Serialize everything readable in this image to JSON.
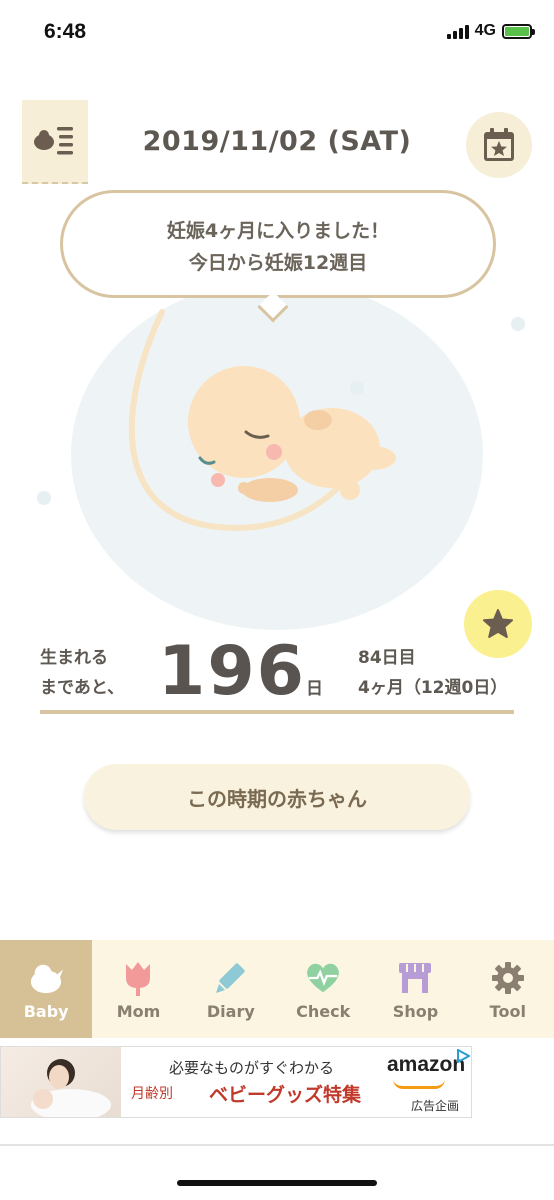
{
  "status": {
    "time": "6:48",
    "network": "4G"
  },
  "header": {
    "date": "2019/11/02 (SAT)"
  },
  "bubble": {
    "line1": "妊娠4ヶ月に入りました！",
    "line2": "今日から妊娠12週目"
  },
  "countdown": {
    "left_line1": "生まれる",
    "left_line2": "まであと、",
    "days": "196",
    "unit": "日",
    "right_line1": "84日目",
    "right_line2": "4ヶ月（12週0日）"
  },
  "baby_button": {
    "label": "この時期の赤ちゃん"
  },
  "tabs": [
    {
      "label": "Baby",
      "icon": "bird-icon",
      "active": true
    },
    {
      "label": "Mom",
      "icon": "tulip-icon",
      "active": false
    },
    {
      "label": "Diary",
      "icon": "pencil-icon",
      "active": false
    },
    {
      "label": "Check",
      "icon": "heart-pulse-icon",
      "active": false
    },
    {
      "label": "Shop",
      "icon": "shop-icon",
      "active": false
    },
    {
      "label": "Tool",
      "icon": "gear-icon",
      "active": false
    }
  ],
  "ad": {
    "line1": "必要なものがすぐわかる",
    "line2_prefix": "月齢別",
    "line2_main": "ベビーグッズ特集",
    "brand": "amazon",
    "tag": "広告企画"
  },
  "colors": {
    "accent": "#d6c096",
    "tabbar_bg": "#fbf5e2",
    "star_bg": "#fbf08f",
    "bubble_border": "#d8c4a0"
  }
}
